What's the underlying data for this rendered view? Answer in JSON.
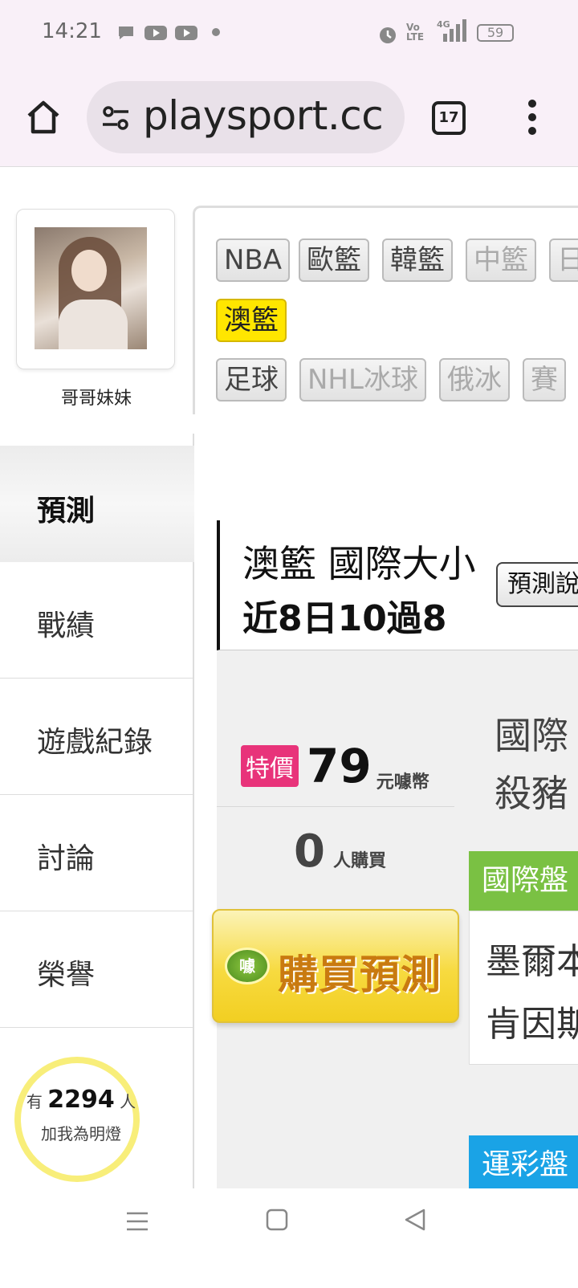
{
  "status_bar": {
    "time": "14:21",
    "battery": "59",
    "icons": [
      "chat-icon",
      "youtube-icon",
      "youtube-icon",
      "dot-icon",
      "alarm-icon",
      "volte-icon",
      "signal-4g-icon",
      "battery-icon"
    ]
  },
  "browser": {
    "url": "playsport.cc",
    "tab_count": "17"
  },
  "profile": {
    "name": "哥哥妹妹"
  },
  "sidebar": {
    "items": [
      {
        "label": "預測"
      },
      {
        "label": "戰績"
      },
      {
        "label": "遊戲紀錄"
      },
      {
        "label": "討論"
      },
      {
        "label": "榮譽"
      }
    ],
    "fans_prefix": "有",
    "fans_count": "2294",
    "fans_suffix": "人",
    "fans_text": "加我為明燈"
  },
  "leagues": {
    "row1": [
      "NBA",
      "歐籃",
      "韓籃",
      "中籃",
      "日"
    ],
    "row2": [
      "澳籃"
    ],
    "row3": [
      "足球",
      "NHL冰球",
      "俄冰",
      "賽"
    ]
  },
  "prediction": {
    "title_line1": "澳籃 國際大小",
    "title_line2": "近8日10過8",
    "button": "預測說",
    "special_label": "特價",
    "price": "79",
    "unit": "元噱幣",
    "buyers": "0",
    "buyers_label": "人購買",
    "buy_button": "購買預測",
    "buy_coin": "噱",
    "right_line1": "國際",
    "right_line2": "殺豬",
    "green_header": "國際盤",
    "team1": "墨爾本",
    "team2": "肯因斯",
    "blue_header": "運彩盤"
  },
  "colors": {
    "accent_yellow": "#ffe600",
    "special_pink": "#e8337a",
    "green": "#7ac143",
    "blue": "#1aa3e6"
  }
}
